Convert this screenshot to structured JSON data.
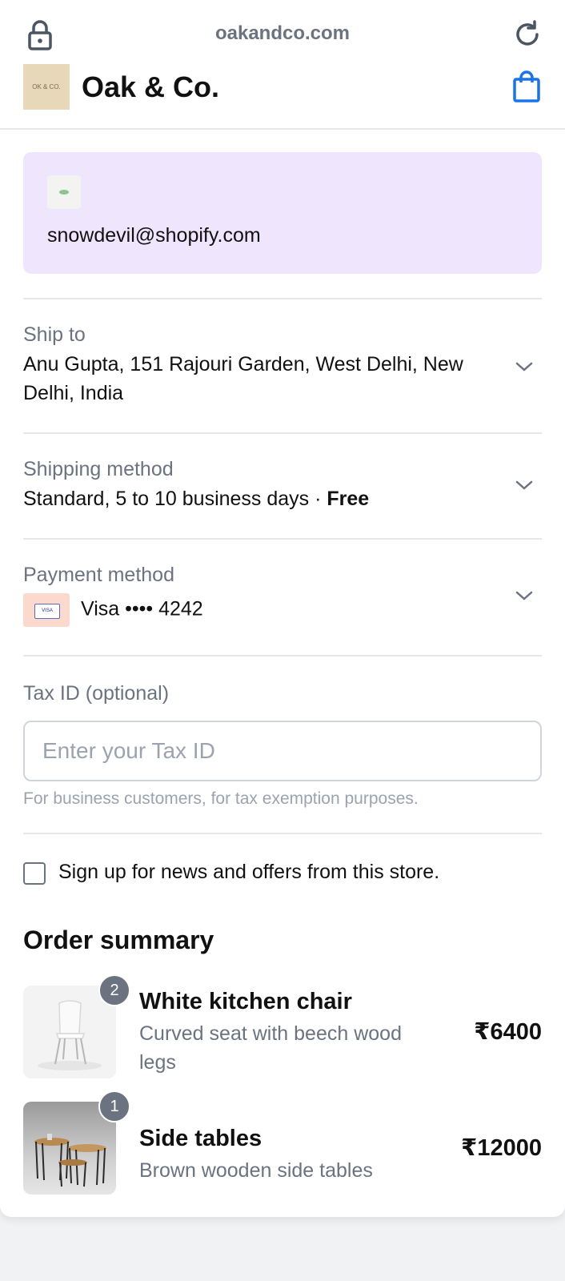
{
  "header": {
    "url": "oakandco.com",
    "store_name": "Oak & Co.",
    "logo_text": "OK & CO."
  },
  "account": {
    "email": "snowdevil@shopify.com"
  },
  "ship_to": {
    "label": "Ship to",
    "value": "Anu Gupta, 151 Rajouri Garden, West Delhi, New Delhi, India"
  },
  "shipping_method": {
    "label": "Shipping method",
    "value": "Standard, 5 to 10 business days · ",
    "price": "Free"
  },
  "payment_method": {
    "label": "Payment method",
    "card_brand_icon_text": "VISA",
    "value": "Visa •••• 4242"
  },
  "tax": {
    "label": "Tax ID (optional)",
    "placeholder": "Enter your Tax ID",
    "value": "",
    "help": "For business customers, for tax exemption purposes."
  },
  "newsletter": {
    "label": "Sign up for news and offers from this store.",
    "checked": false
  },
  "order_summary": {
    "title": "Order summary",
    "items": [
      {
        "name": "White kitchen chair",
        "description": "Curved seat with beech wood legs",
        "quantity": "2",
        "price": "₹6400"
      },
      {
        "name": "Side tables",
        "description": "Brown wooden side tables",
        "quantity": "1",
        "price": "₹12000"
      }
    ]
  },
  "colors": {
    "accent": "#1a73e8",
    "email_card_bg": "#efe5fd",
    "badge": "#6b7280"
  },
  "icons": [
    "lock-icon",
    "reload-icon",
    "shopping-bag-icon",
    "chevron-down-icon",
    "credit-card-icon"
  ]
}
